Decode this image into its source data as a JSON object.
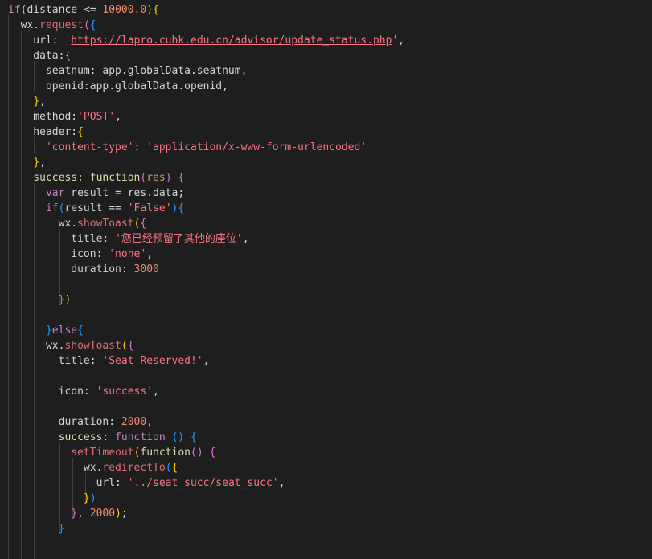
{
  "code": {
    "lines": [
      [
        {
          "t": "if",
          "c": "ctrl"
        },
        {
          "t": "(",
          "c": "b1"
        },
        {
          "t": "distance ",
          "c": "id"
        },
        {
          "t": "<= ",
          "c": "op"
        },
        {
          "t": "10000.0",
          "c": "num"
        },
        {
          "t": ")",
          "c": "b1"
        },
        {
          "t": "{",
          "c": "b1"
        }
      ],
      [
        {
          "t": "  wx.",
          "c": "id"
        },
        {
          "t": "request",
          "c": "method"
        },
        {
          "t": "(",
          "c": "b2"
        },
        {
          "t": "{",
          "c": "b3"
        }
      ],
      [
        {
          "t": "    url: ",
          "c": "prop"
        },
        {
          "t": "'",
          "c": "strr"
        },
        {
          "t": "https://lapro.cuhk.edu.cn/advisor/update_status.php",
          "c": "url"
        },
        {
          "t": "'",
          "c": "strr"
        },
        {
          "t": ",",
          "c": "pun"
        }
      ],
      [
        {
          "t": "    data:",
          "c": "prop"
        },
        {
          "t": "{",
          "c": "b1"
        }
      ],
      [
        {
          "t": "      seatnum: app.globalData.seatnum,",
          "c": "prop"
        }
      ],
      [
        {
          "t": "      openid:app.globalData.openid,",
          "c": "prop"
        }
      ],
      [
        {
          "t": "    ",
          "c": "pun"
        },
        {
          "t": "}",
          "c": "b1"
        },
        {
          "t": ",",
          "c": "pun"
        }
      ],
      [
        {
          "t": "    method:",
          "c": "prop"
        },
        {
          "t": "'POST'",
          "c": "strr"
        },
        {
          "t": ",",
          "c": "pun"
        }
      ],
      [
        {
          "t": "    header:",
          "c": "prop"
        },
        {
          "t": "{",
          "c": "b1"
        }
      ],
      [
        {
          "t": "      ",
          "c": "pun"
        },
        {
          "t": "'content-type'",
          "c": "strr"
        },
        {
          "t": ": ",
          "c": "pun"
        },
        {
          "t": "'application/x-www-form-urlencoded'",
          "c": "strr"
        }
      ],
      [
        {
          "t": "    ",
          "c": "pun"
        },
        {
          "t": "}",
          "c": "b1"
        },
        {
          "t": ",",
          "c": "pun"
        }
      ],
      [
        {
          "t": "    success: ",
          "c": "fn"
        },
        {
          "t": "function",
          "c": "fn"
        },
        {
          "t": "(",
          "c": "b2"
        },
        {
          "t": "res",
          "c": "var"
        },
        {
          "t": ") ",
          "c": "b2"
        },
        {
          "t": "{",
          "c": "b2"
        }
      ],
      [
        {
          "t": "      ",
          "c": "pun"
        },
        {
          "t": "var ",
          "c": "kw"
        },
        {
          "t": "result = res.data;",
          "c": "id"
        }
      ],
      [
        {
          "t": "      ",
          "c": "pun"
        },
        {
          "t": "if",
          "c": "kw"
        },
        {
          "t": "(",
          "c": "b3"
        },
        {
          "t": "result == ",
          "c": "id"
        },
        {
          "t": "'False'",
          "c": "strr"
        },
        {
          "t": ")",
          "c": "b3"
        },
        {
          "t": "{",
          "c": "b3"
        }
      ],
      [
        {
          "t": "        wx.",
          "c": "id"
        },
        {
          "t": "showToast",
          "c": "method"
        },
        {
          "t": "(",
          "c": "b1"
        },
        {
          "t": "{",
          "c": "b2"
        }
      ],
      [
        {
          "t": "          title: ",
          "c": "prop"
        },
        {
          "t": "'您已经预留了其他的座位'",
          "c": "strr"
        },
        {
          "t": ",",
          "c": "pun"
        }
      ],
      [
        {
          "t": "          icon: ",
          "c": "prop"
        },
        {
          "t": "'none'",
          "c": "strr"
        },
        {
          "t": ",",
          "c": "pun"
        }
      ],
      [
        {
          "t": "          duration: ",
          "c": "prop"
        },
        {
          "t": "3000",
          "c": "num"
        }
      ],
      [
        {
          "t": "",
          "c": "pun"
        }
      ],
      [
        {
          "t": "        ",
          "c": "pun"
        },
        {
          "t": "}",
          "c": "b2"
        },
        {
          "t": ")",
          "c": "b1"
        }
      ],
      [
        {
          "t": "",
          "c": "pun"
        }
      ],
      [
        {
          "t": "      ",
          "c": "pun"
        },
        {
          "t": "}",
          "c": "b3"
        },
        {
          "t": "else",
          "c": "kw"
        },
        {
          "t": "{",
          "c": "b3"
        }
      ],
      [
        {
          "t": "      wx.",
          "c": "id"
        },
        {
          "t": "showToast",
          "c": "method"
        },
        {
          "t": "(",
          "c": "b1"
        },
        {
          "t": "{",
          "c": "b2"
        }
      ],
      [
        {
          "t": "        title: ",
          "c": "prop"
        },
        {
          "t": "'Seat Reserved!'",
          "c": "strr"
        },
        {
          "t": ",",
          "c": "pun"
        }
      ],
      [
        {
          "t": "",
          "c": "pun"
        }
      ],
      [
        {
          "t": "        icon: ",
          "c": "prop"
        },
        {
          "t": "'success'",
          "c": "strr"
        },
        {
          "t": ",",
          "c": "pun"
        }
      ],
      [
        {
          "t": "",
          "c": "pun"
        }
      ],
      [
        {
          "t": "        duration: ",
          "c": "prop"
        },
        {
          "t": "2000",
          "c": "num"
        },
        {
          "t": ",",
          "c": "pun"
        }
      ],
      [
        {
          "t": "        success: ",
          "c": "fn"
        },
        {
          "t": "function ",
          "c": "kw"
        },
        {
          "t": "() ",
          "c": "b3"
        },
        {
          "t": "{",
          "c": "b3"
        }
      ],
      [
        {
          "t": "          ",
          "c": "pun"
        },
        {
          "t": "setTimeout",
          "c": "method"
        },
        {
          "t": "(",
          "c": "b1"
        },
        {
          "t": "function",
          "c": "fn"
        },
        {
          "t": "() ",
          "c": "b2"
        },
        {
          "t": "{",
          "c": "b2"
        }
      ],
      [
        {
          "t": "            wx.",
          "c": "id"
        },
        {
          "t": "redirectTo",
          "c": "method"
        },
        {
          "t": "(",
          "c": "b3"
        },
        {
          "t": "{",
          "c": "b1"
        }
      ],
      [
        {
          "t": "              url: ",
          "c": "prop"
        },
        {
          "t": "'../seat_succ/seat_succ'",
          "c": "strr"
        },
        {
          "t": ",",
          "c": "pun"
        }
      ],
      [
        {
          "t": "            ",
          "c": "pun"
        },
        {
          "t": "}",
          "c": "b1"
        },
        {
          "t": ")",
          "c": "b3"
        }
      ],
      [
        {
          "t": "          ",
          "c": "pun"
        },
        {
          "t": "}",
          "c": "b2"
        },
        {
          "t": ", ",
          "c": "pun"
        },
        {
          "t": "2000",
          "c": "num"
        },
        {
          "t": ")",
          "c": "b1"
        },
        {
          "t": ";",
          "c": "pun"
        }
      ],
      [
        {
          "t": "        ",
          "c": "pun"
        },
        {
          "t": "}",
          "c": "b3"
        }
      ],
      [
        {
          "t": "",
          "c": "pun"
        }
      ]
    ]
  }
}
